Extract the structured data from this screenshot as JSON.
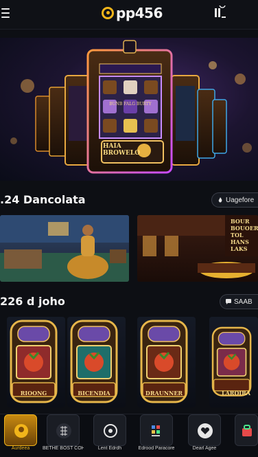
{
  "header": {
    "logo_text": "pp456",
    "menu_icon": "hamburger-icon",
    "right_icon": "pause-icon",
    "accent": "#f2b51a"
  },
  "hero": {
    "sign_top": "BUNB FALG BURTY",
    "sign_main": "HAIA BROWELO"
  },
  "section1": {
    "title": ".24 Dancolata",
    "button_label": "Uagefore",
    "button_icon": "flame-icon",
    "card2_text": "BOUR BOUOER TOL HANS LAKS"
  },
  "section2": {
    "title": "226 d joho",
    "button_label": "SAAB",
    "button_icon": "chat-icon",
    "slots": [
      {
        "name": "RIOONG",
        "screen": "#8f2b2b"
      },
      {
        "name": "BICENDIA",
        "screen": "#1f6e6a"
      },
      {
        "name": "DRAUNNER",
        "screen": "#6a2a16"
      },
      {
        "name": "LAROIRA",
        "screen": "#7a2b4a"
      }
    ]
  },
  "bottom_nav": [
    {
      "label": "Aurdeea",
      "icon": "home-gold-icon",
      "active": true
    },
    {
      "label": "BETHE BOST COHERE",
      "icon": "grid-icon",
      "active": false
    },
    {
      "label": "Lent Edrdh",
      "icon": "settings-icon",
      "active": false
    },
    {
      "label": "Edrood Paracore",
      "icon": "apps-icon",
      "active": false
    },
    {
      "label": "Dearl Agee",
      "icon": "heart-icon",
      "active": false
    },
    {
      "label": "",
      "icon": "bag-icon",
      "active": false
    }
  ]
}
